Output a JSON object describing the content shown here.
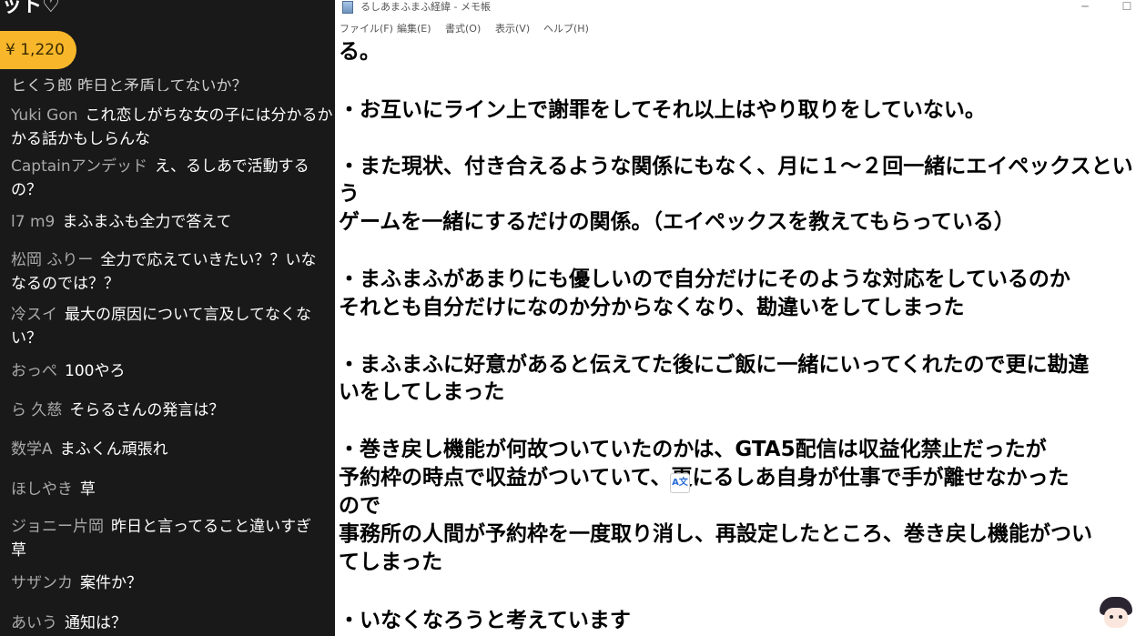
{
  "chat": {
    "header": "ット♡",
    "superchat_amount": "¥ 1,220",
    "clipped_message": "ヒくう郎  昨日と矛盾してないか？",
    "messages": [
      {
        "author": "Yuki Gon",
        "text": "これ恋しがちな女の子には分かるか",
        "cont": "かる話かもしらんな"
      },
      {
        "author": "Captainアンデッド",
        "text": "え、るしあで活動する",
        "cont": "の？"
      },
      {
        "author": "l7 m9",
        "text": "まふまふも全力で答えて",
        "cont": ""
      },
      {
        "author": "松岡 ふりー",
        "text": "全力で応えていきたい？？いな",
        "cont": "なるのでは？？"
      },
      {
        "author": "冷スイ",
        "text": "最大の原因について言及してなくな",
        "cont": "い？"
      },
      {
        "author": "おっぺ",
        "text": "100やろ",
        "cont": ""
      },
      {
        "author": "ら 久慈",
        "text": "そらるさんの発言は？",
        "cont": ""
      },
      {
        "author": "数学A",
        "text": "まふくん頑張れ",
        "cont": ""
      },
      {
        "author": "ほしやき",
        "text": "草",
        "cont": ""
      },
      {
        "author": "ジョニー片岡",
        "text": "昨日と言ってること違いすぎ",
        "cont": "草"
      },
      {
        "author": "サザンカ",
        "text": "案件か？",
        "cont": ""
      },
      {
        "author": "あいう",
        "text": "通知は？",
        "cont": ""
      }
    ]
  },
  "notepad": {
    "title": "るしあまふまふ経緯 - メモ帳",
    "minimize": "─",
    "maximize": "☐",
    "menu": [
      "ファイル(F)",
      "編集(E)",
      "書式(O)",
      "表示(V)",
      "ヘルプ(H)"
    ],
    "lines": [
      "る。",
      "・お互いにライン上で謝罪をしてそれ以上はやり取りをしていない。",
      "・また現状、付き合えるような関係にもなく、月に１～２回一緒にエイペックスとい",
      "う",
      "ゲームを一緒にするだけの関係。（エイペックスを教えてもらっている）",
      "・まふまふがあまりにも優しいので自分だけにそのような対応をしているのか",
      "それとも自分だけになのか分からなくなり、勘違いをしてしまった",
      "・まふまふに好意があると伝えてた後にご飯に一緒にいってくれたので更に勘違",
      "いをしてしまった",
      "・巻き戻し機能が何故ついていたのかは、GTA5配信は収益化禁止だったが",
      "予約枠の時点で収益がついていて、更にるしあ自身が仕事で手が離せなかった",
      "ので",
      "事務所の人間が予約枠を一度取り消し、再設定したところ、巻き戻し機能がつい",
      "てしまった",
      "・いなくなろうと考えています"
    ]
  },
  "overlay": {
    "translate_glyph": "A文"
  }
}
